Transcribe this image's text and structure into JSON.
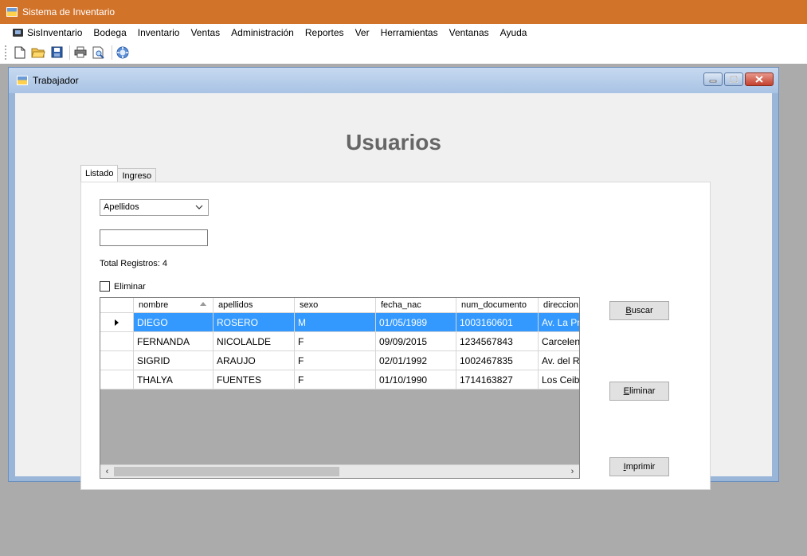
{
  "app": {
    "title": "Sistema de Inventario"
  },
  "menu": {
    "items": [
      "SisInventario",
      "Bodega",
      "Inventario",
      "Ventas",
      "Administración",
      "Reportes",
      "Ver",
      "Herramientas",
      "Ventanas",
      "Ayuda"
    ]
  },
  "toolbar": {
    "buttons": [
      "new-file-icon",
      "open-folder-icon",
      "save-icon",
      "print-icon",
      "print-preview-icon",
      "help-icon"
    ]
  },
  "child_window": {
    "title": "Trabajador"
  },
  "page": {
    "title": "Usuarios"
  },
  "tabs": [
    "Listado",
    "Ingreso"
  ],
  "form": {
    "search_field": "Apellidos",
    "search_text": "",
    "total_label": "Total Registros: 4",
    "delete_checkbox_label": "Eliminar"
  },
  "grid": {
    "columns": [
      "nombre",
      "apellidos",
      "sexo",
      "fecha_nac",
      "num_documento",
      "direccion"
    ],
    "rows": [
      [
        "DIEGO",
        "ROSERO",
        "M",
        "01/05/1989",
        "1003160601",
        "Av. La Pre"
      ],
      [
        "FERNANDA",
        "NICOLALDE",
        "F",
        "09/09/2015",
        "1234567843",
        "Carcelen"
      ],
      [
        "SIGRID",
        "ARAUJO",
        "F",
        "02/01/1992",
        "1002467835",
        "Av. del Re"
      ],
      [
        "THALYA",
        "FUENTES",
        "F",
        "01/10/1990",
        "1714163827",
        "Los Ceibos"
      ]
    ],
    "selected_row": 0
  },
  "buttons": {
    "search": {
      "label": "Buscar",
      "accel": "B",
      "rest": "uscar"
    },
    "delete": {
      "label": "Eliminar",
      "accel": "E",
      "rest": "liminar"
    },
    "print": {
      "label": "Imprimir",
      "accel": "I",
      "rest": "mprimir"
    }
  },
  "colors": {
    "titlebar": "#d2732a",
    "selection": "#3399ff",
    "title_text": "#666666"
  }
}
